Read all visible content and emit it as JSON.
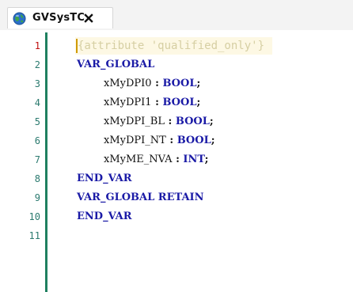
{
  "tab": {
    "title": "GVSysTC",
    "icon": "globe-icon",
    "close_icon": "close-icon"
  },
  "editor": {
    "line_numbers": [
      "1",
      "2",
      "3",
      "4",
      "5",
      "6",
      "7",
      "8",
      "9",
      "10",
      "11"
    ],
    "attribute": "{attribute 'qualified_only'}",
    "lines": {
      "l2": "VAR_GLOBAL",
      "l3_name": "xMyDPI0",
      "l3_sep": " : ",
      "l3_type": "BOOL",
      "l3_end": ";",
      "l4_name": "xMyDPI1",
      "l4_sep": " : ",
      "l4_type": "BOOL",
      "l4_end": ";",
      "l5_name": "xMyDPI_BL",
      "l5_sep": " : ",
      "l5_type": "BOOL",
      "l5_end": ";",
      "l6_name": "xMyDPI_NT",
      "l6_sep": " : ",
      "l6_type": "BOOL",
      "l6_end": ";",
      "l7_name": "xMyME_NVA",
      "l7_sep": " : ",
      "l7_type": "INT",
      "l7_end": ";",
      "l8": "END_VAR",
      "l9": "VAR_GLOBAL RETAIN",
      "l10": "END_VAR"
    }
  },
  "colors": {
    "keyword": "#1a1aa6",
    "line_number": "#2b7a6f",
    "active_line_number": "#c01010",
    "gutter_bar": "#1f8060",
    "attribute_text": "#d6cfa3"
  }
}
